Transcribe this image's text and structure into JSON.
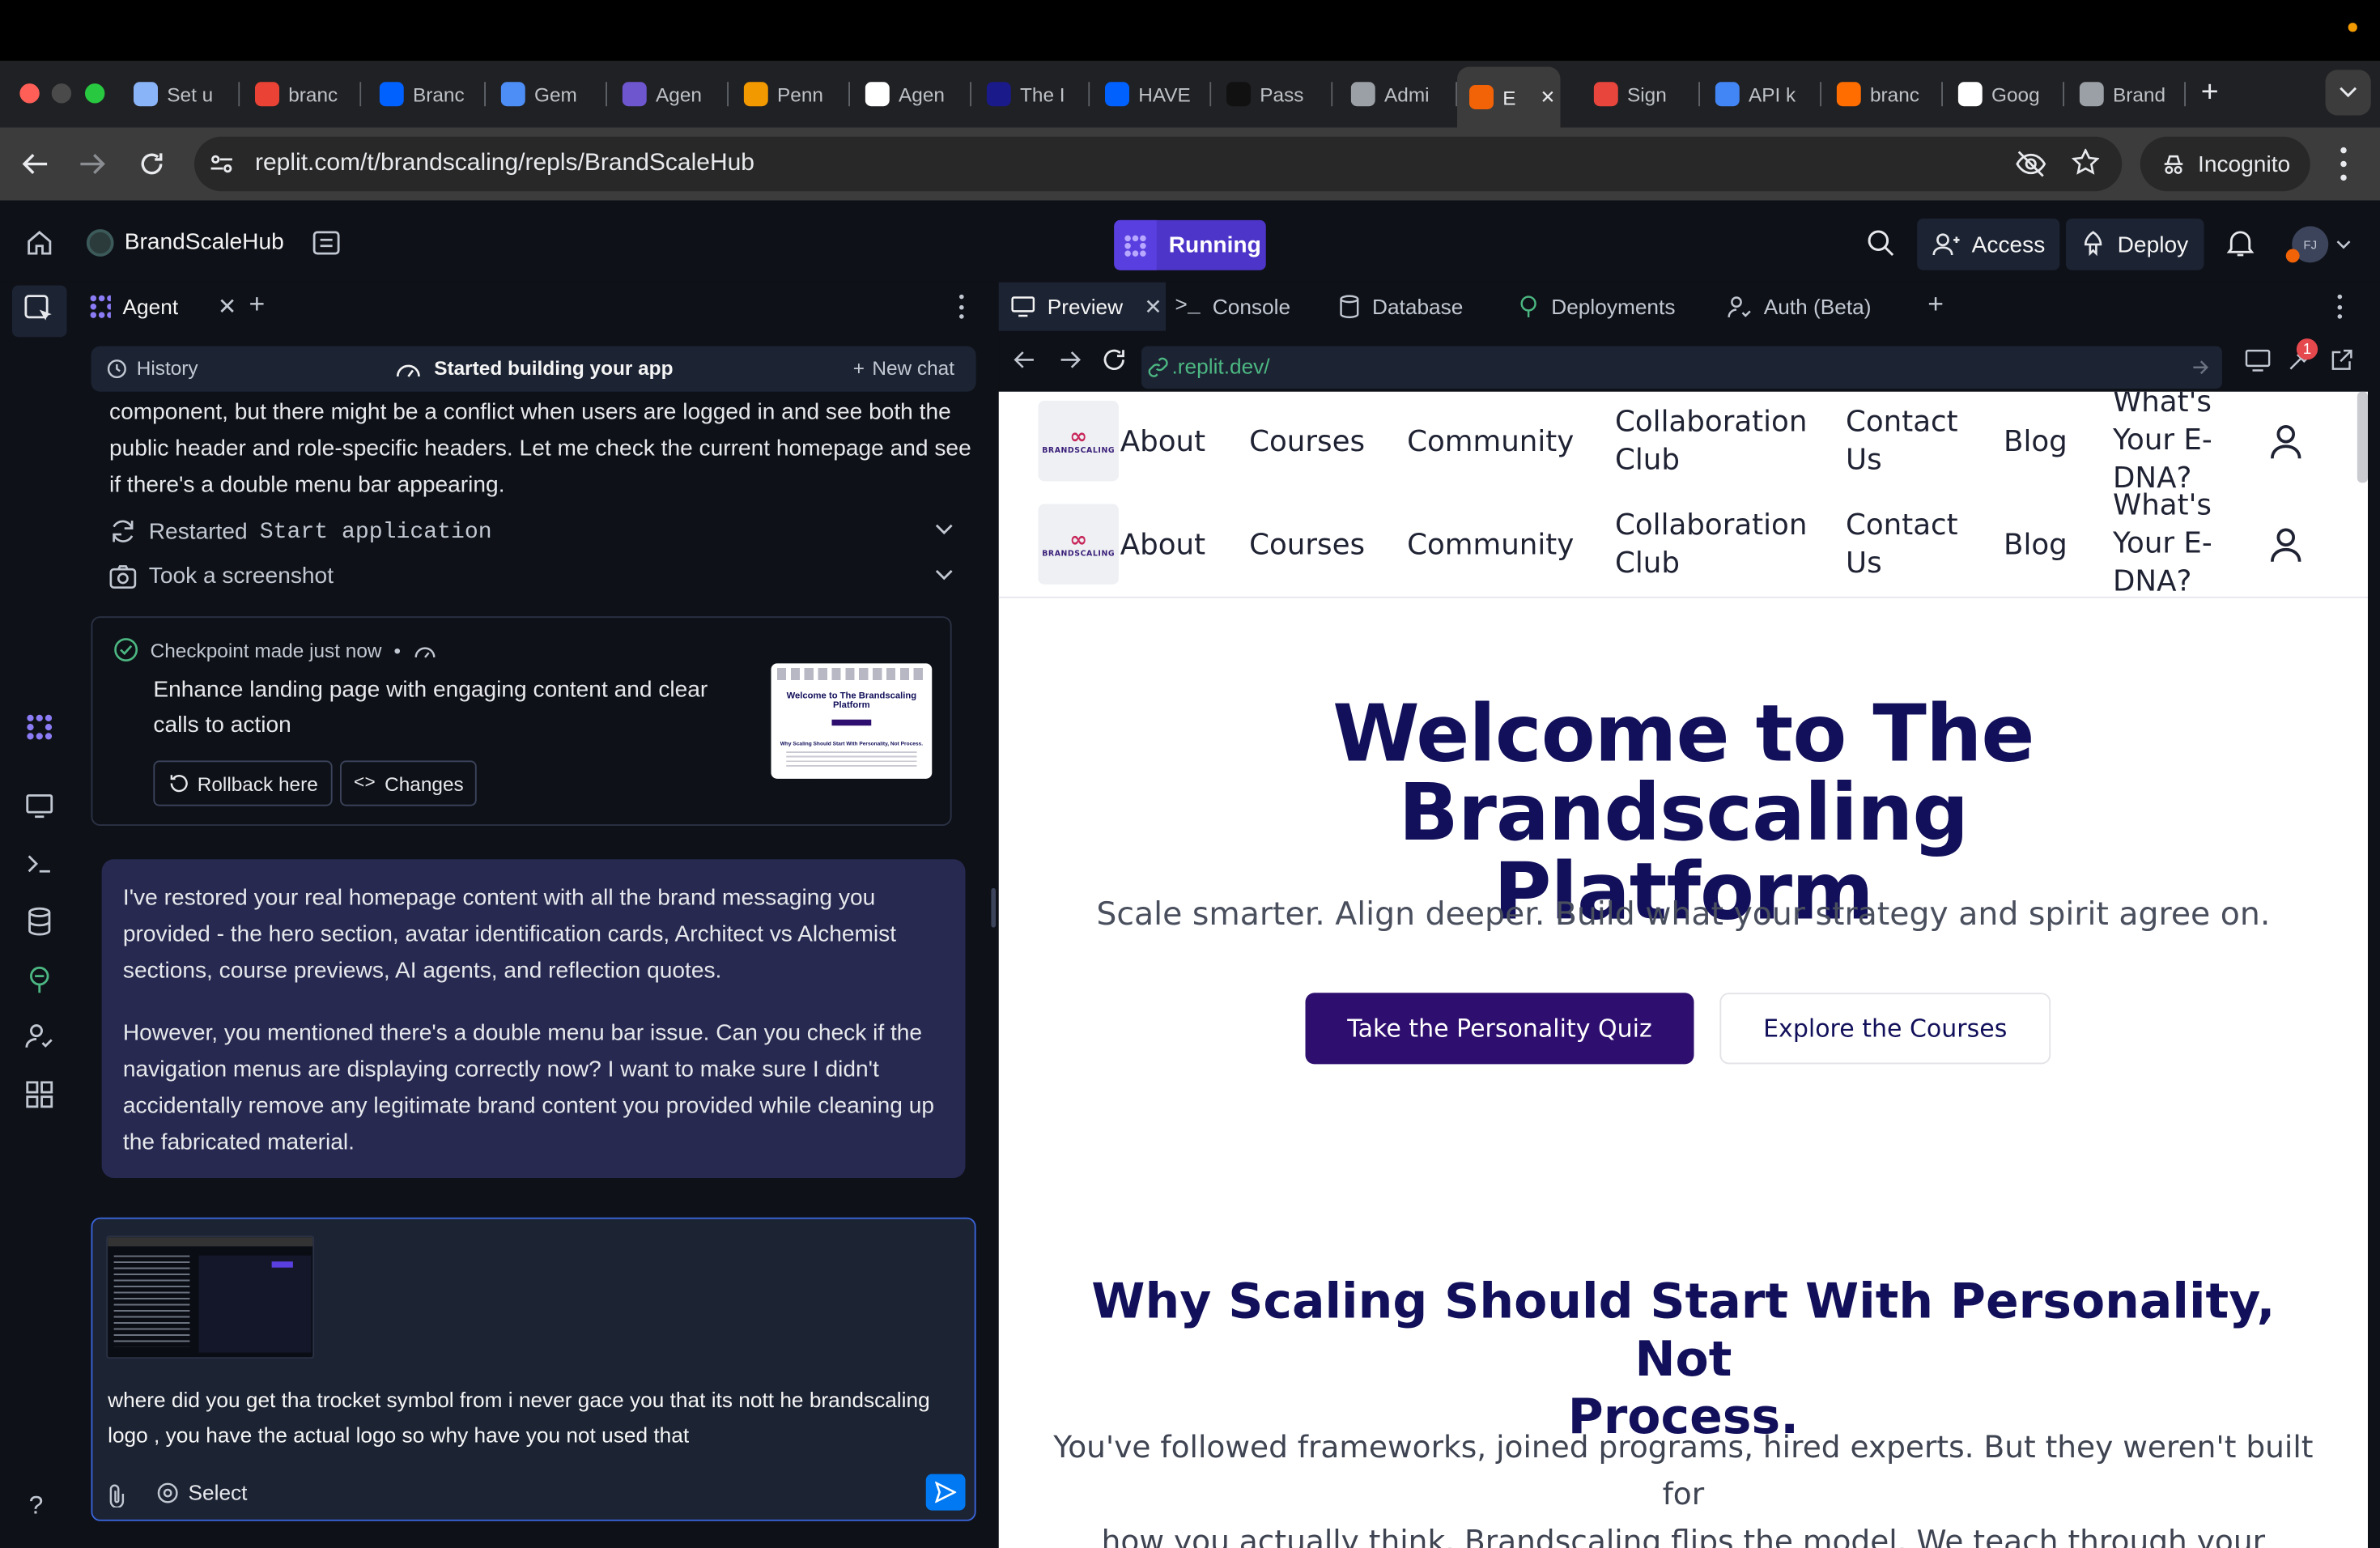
{
  "browser": {
    "tabs": [
      {
        "title": "Set u",
        "icon": "loop-icon",
        "color": "#8ab4f8"
      },
      {
        "title": "branc",
        "icon": "doc-icon",
        "color": "#ea4335"
      },
      {
        "title": "Branc",
        "icon": "dropbox-icon",
        "color": "#0061ff"
      },
      {
        "title": "Gem",
        "icon": "gemini-icon",
        "color": "#4c8df6"
      },
      {
        "title": "Agen",
        "icon": "agent-icon",
        "color": "#6e56cf"
      },
      {
        "title": "Penn",
        "icon": "penn-icon",
        "color": "#f29900"
      },
      {
        "title": "Agen",
        "icon": "triangle-icon",
        "color": "#ffffff"
      },
      {
        "title": "The I",
        "icon": "moon-icon",
        "color": "#1a1a8a"
      },
      {
        "title": "HAVE",
        "icon": "dropbox-icon",
        "color": "#0061ff"
      },
      {
        "title": "Pass",
        "icon": "up-icon",
        "color": "#111111"
      },
      {
        "title": "Admi",
        "icon": "globe-icon",
        "color": "#9aa0a6"
      },
      {
        "title": "E",
        "icon": "replit-icon",
        "color": "#f26207"
      },
      {
        "title": "Sign",
        "icon": "sign-icon",
        "color": "#e8453c"
      },
      {
        "title": "API k",
        "icon": "api-icon",
        "color": "#4285f4"
      },
      {
        "title": "branc",
        "icon": "fire-icon",
        "color": "#ff6d00"
      },
      {
        "title": "Goog",
        "icon": "google-icon",
        "color": "#ffffff"
      },
      {
        "title": "Brand",
        "icon": "globe-icon",
        "color": "#9aa0a6"
      }
    ],
    "url": "replit.com/t/brandscaling/repls/BrandScaleHub",
    "incognito_label": "Incognito"
  },
  "header": {
    "project_name": "BrandScaleHub",
    "running_label": "Running",
    "access_label": "Access",
    "deploy_label": "Deploy",
    "avatar_initials": "FJ"
  },
  "agent": {
    "tab_label": "Agent",
    "history_label": "History",
    "status_label": "Started building your app",
    "new_chat_label": "New chat",
    "partial_text": "component, but there might be a conflict when users are logged in and see both the public header and role-specific headers. Let me check the current homepage and see if there's a double menu bar appearing.",
    "tool1_prefix": "Restarted",
    "tool1_code": "Start application",
    "tool2": "Took a screenshot",
    "checkpoint_label": "Checkpoint made just now",
    "checkpoint_bullet": "•",
    "checkpoint_title": "Enhance landing page with engaging content and clear calls to action",
    "rollback_label": "Rollback here",
    "changes_label": "Changes",
    "thumb_title": "Welcome to The Brandscaling Platform",
    "thumb_sub": "Why Scaling Should Start With Personality, Not Process.",
    "message_p1": "I've restored your real homepage content with all the brand messaging you provided - the hero section, avatar identification cards, Architect vs Alchemist sections, course previews, AI agents, and reflection quotes.",
    "message_p2": "However, you mentioned there's a double menu bar issue. Can you check if the navigation menus are displaying correctly now? I want to make sure I didn't accidentally remove any legitimate brand content you provided while cleaning up the fabricated material.",
    "composer_text": "where did you get tha trocket symbol from i never gace you that its nott he brandscaling logo , you have the actual logo so why have you not used that",
    "select_label": "Select"
  },
  "preview": {
    "tabs": [
      "Preview",
      "Console",
      "Database",
      "Deployments",
      "Auth (Beta)"
    ],
    "url": ".replit.dev/",
    "badge_count": "1",
    "logo_text": "BRANDSCALING",
    "nav": {
      "about": "About",
      "courses": "Courses",
      "community": "Community",
      "collab1": "Collaboration",
      "collab2": "Club",
      "contact1": "Contact",
      "contact2": "Us",
      "blog": "Blog",
      "edna1": "What's",
      "edna2": "Your E-",
      "edna3": "DNA?"
    },
    "hero_title_l1": "Welcome to The Brandscaling",
    "hero_title_l2": "Platform",
    "hero_subtitle": "Scale smarter. Align deeper. Build what your strategy and spirit agree on.",
    "cta_primary": "Take the Personality Quiz",
    "cta_secondary": "Explore the Courses",
    "why_title_l1": "Why Scaling Should Start With Personality, Not",
    "why_title_l2": "Process.",
    "why_body_l1": "You've followed frameworks, joined programs, hired experts. But they weren't built for",
    "why_body_l2": "how you actually think. Brandscaling flips the model. We teach through your operating"
  },
  "colors": {
    "accent": "#4e35c9",
    "brand_dark": "#12105a",
    "cta_purple": "#2e0e6e",
    "agent_bubble": "#272950"
  }
}
